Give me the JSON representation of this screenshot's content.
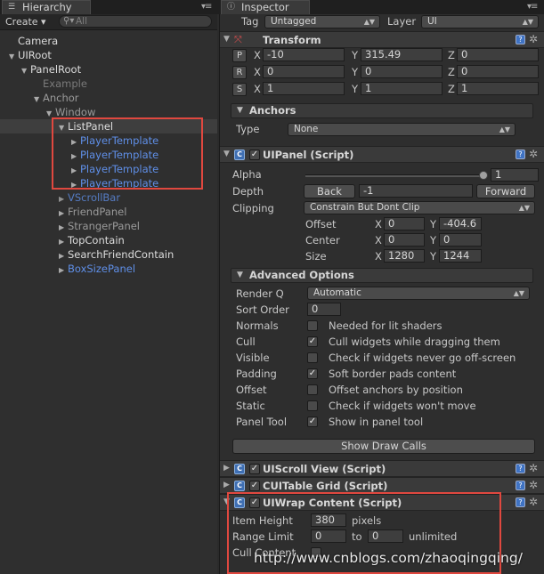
{
  "hierarchy": {
    "tab_label": "Hierarchy",
    "create_label": "Create ▾",
    "search_placeholder": "All",
    "items": [
      {
        "label": "Camera"
      },
      {
        "label": "UIRoot"
      },
      {
        "label": "PanelRoot"
      },
      {
        "label": "Example"
      },
      {
        "label": "Anchor"
      },
      {
        "label": "Window"
      },
      {
        "label": "ListPanel"
      },
      {
        "label": "PlayerTemplate"
      },
      {
        "label": "PlayerTemplate"
      },
      {
        "label": "PlayerTemplate"
      },
      {
        "label": "PlayerTemplate"
      },
      {
        "label": "VScrollBar"
      },
      {
        "label": "FriendPanel"
      },
      {
        "label": "StrangerPanel"
      },
      {
        "label": "TopContain"
      },
      {
        "label": "SearchFriendContain"
      },
      {
        "label": "BoxSizePanel"
      }
    ]
  },
  "inspector": {
    "tab_label": "Inspector",
    "tag_label": "Tag",
    "tag_value": "Untagged",
    "layer_label": "Layer",
    "layer_value": "UI",
    "transform": {
      "title": "Transform",
      "rows": [
        {
          "btn": "P",
          "x": "-10",
          "y": "315.49",
          "z": "0"
        },
        {
          "btn": "R",
          "x": "0",
          "y": "0",
          "z": "0"
        },
        {
          "btn": "S",
          "x": "1",
          "y": "1",
          "z": "1"
        }
      ],
      "x_label": "X",
      "y_label": "Y",
      "z_label": "Z"
    },
    "anchors": {
      "title": "Anchors",
      "type_label": "Type",
      "type_value": "None"
    },
    "uipanel": {
      "title": "UIPanel (Script)",
      "alpha_label": "Alpha",
      "alpha_value": "1",
      "alpha_level": 1,
      "depth_label": "Depth",
      "back_label": "Back",
      "depth_value": "-1",
      "forward_label": "Forward",
      "clipping_label": "Clipping",
      "clipping_value": "Constrain But Dont Clip",
      "offset_label": "Offset",
      "offset_x": "0",
      "offset_y": "-404.6",
      "center_label": "Center",
      "center_x": "0",
      "center_y": "0",
      "size_label": "Size",
      "size_x": "1280",
      "size_y": "1244",
      "advanced_title": "Advanced Options",
      "renderq_label": "Render Q",
      "renderq_value": "Automatic",
      "sortorder_label": "Sort Order",
      "sortorder_value": "0",
      "options": [
        {
          "label": "Normals",
          "checked": false,
          "text": "Needed for lit shaders"
        },
        {
          "label": "Cull",
          "checked": true,
          "text": "Cull widgets while dragging them"
        },
        {
          "label": "Visible",
          "checked": false,
          "text": "Check if widgets never go off-screen"
        },
        {
          "label": "Padding",
          "checked": true,
          "text": "Soft border pads content"
        },
        {
          "label": "Offset",
          "checked": false,
          "text": "Offset anchors by position"
        },
        {
          "label": "Static",
          "checked": false,
          "text": "Check if widgets won't move"
        },
        {
          "label": "Panel Tool",
          "checked": true,
          "text": "Show in panel tool"
        }
      ],
      "show_draw_calls": "Show Draw Calls"
    },
    "components": [
      {
        "title": "UIScroll View (Script)"
      },
      {
        "title": "CUITable Grid (Script)"
      }
    ],
    "wrap": {
      "title": "UIWrap Content (Script)",
      "item_height_label": "Item Height",
      "item_height_value": "380",
      "pixels_label": "pixels",
      "range_label": "Range Limit",
      "range_min": "0",
      "to_label": "to",
      "range_max": "0",
      "unlimited_label": "unlimited",
      "cull_label": "Cull Content"
    }
  },
  "watermark": "http://www.cnblogs.com/zhaoqingqing/",
  "colors": {
    "highlight_box": "#e0483f",
    "prefab_blue": "#5f8fe8"
  }
}
